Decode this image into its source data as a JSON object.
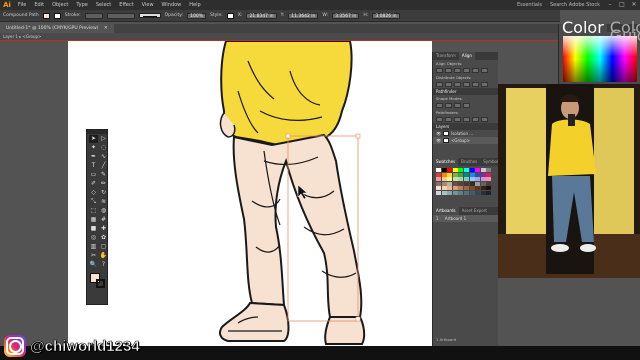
{
  "app": {
    "logo": "Ai",
    "workspace": "Essentials",
    "search_placeholder": "Search Adobe Stock"
  },
  "menu": {
    "items": [
      "File",
      "Edit",
      "Object",
      "Type",
      "Select",
      "Effect",
      "View",
      "Window",
      "Help"
    ]
  },
  "window_buttons": {
    "minimize": "–",
    "maximize": "□",
    "close": "✕"
  },
  "control_bar": {
    "selection_type": "Compound Path",
    "stroke_label": "Stroke:",
    "opacity_label": "Opacity:",
    "opacity_value": "100%",
    "style_label": "Style:",
    "x_label": "X:",
    "x_value": "21.8347 in",
    "y_label": "Y:",
    "y_value": "11.3642 in",
    "w_label": "W:",
    "w_value": "3.3567 in",
    "h_label": "H:",
    "h_value": "3.0826 in"
  },
  "document": {
    "tab_title": "Untitled-1* @ 100% (CMYK/GPU Preview)",
    "close": "✕",
    "breadcrumb": "Layer 1  ▸  <Group>"
  },
  "tools": {
    "icons": [
      "selection-icon",
      "direct-selection-icon",
      "magic-wand-icon",
      "lasso-icon",
      "pen-icon",
      "curvature-icon",
      "type-icon",
      "line-icon",
      "rectangle-icon",
      "paintbrush-icon",
      "shaper-icon",
      "pencil-icon",
      "eraser-icon",
      "rotate-icon",
      "scale-icon",
      "width-icon",
      "free-transform-icon",
      "shape-builder-icon",
      "perspective-icon",
      "mesh-icon",
      "gradient-icon",
      "eyedropper-icon",
      "blend-icon",
      "symbol-sprayer-icon",
      "column-graph-icon",
      "artboard-icon",
      "slice-icon",
      "hand-icon",
      "zoom-icon",
      "question-icon"
    ],
    "glyphs": [
      "➤",
      "▷",
      "✦",
      "◌",
      "✒",
      "∿",
      "T",
      "╱",
      "▭",
      "✎",
      "✐",
      "✏",
      "◇",
      "↻",
      "⤡",
      "≋",
      "⬚",
      "◍",
      "▦",
      "#",
      "■",
      "✚",
      "◎",
      "✿",
      "▥",
      "▢",
      "✂",
      "✋",
      "🔍",
      "?"
    ],
    "fill_color": "#f7e1d0"
  },
  "panels": {
    "top_tabs": [
      "Transform",
      "Align"
    ],
    "align_objects_label": "Align Objects:",
    "distribute_objects_label": "Distribute Objects:",
    "pathfinder_tab": "Pathfinder",
    "shape_modes_label": "Shape Modes:",
    "pathfinders_label": "Pathfinders:",
    "layers_tab": "Layers",
    "layers": [
      {
        "name": "Isolation ...",
        "selected": false
      },
      {
        "name": "<Group>",
        "selected": true
      }
    ],
    "swatch_tabs": [
      "Swatches",
      "Brushes",
      "Symbols"
    ],
    "swatch_colors": [
      "#ffffff",
      "#000000",
      "#ff0000",
      "#ffff00",
      "#00ff00",
      "#00ffff",
      "#0000ff",
      "#ff00ff",
      "#c8c8c8",
      "#808080",
      "#e53935",
      "#fb8c00",
      "#fdd835",
      "#7cb342",
      "#43a047",
      "#00897b",
      "#1e88e5",
      "#3949ab",
      "#8e24aa",
      "#d81b60",
      "#ef9a9a",
      "#ffcc80",
      "#fff59d",
      "#c5e1a5",
      "#a5d6a7",
      "#80cbc4",
      "#90caf9",
      "#9fa8da",
      "#ce93d8",
      "#f48fb1",
      "#8d6e63",
      "#a1887f",
      "#bcaaa4",
      "#6d4c41",
      "#5d4037",
      "#4e342e",
      "#3e2723",
      "#9e9e9e",
      "#616161",
      "#424242",
      "#f7e1d0",
      "#f5d0b0",
      "#e8b890",
      "#d4a070",
      "#b8805a",
      "#9a6644",
      "#7a4c30",
      "#5c3420",
      "#3e2010",
      "#201008",
      "#cfd8dc",
      "#b0bec5",
      "#90a4ae",
      "#78909c",
      "#607d8b",
      "#546e7a",
      "#455a64",
      "#37474f",
      "#263238",
      "#1b2327"
    ],
    "artboards_tabs": [
      "Artboards",
      "Asset Export"
    ],
    "artboards": [
      {
        "index": "1",
        "name": "Artboard 1"
      }
    ],
    "artboards_footer": "1 Artboard"
  },
  "color_panel": {
    "tabs": [
      "Color",
      "Color Guide"
    ]
  },
  "social": {
    "handle": "@chiworld1234"
  },
  "colors": {
    "skin": "#f7e1d0",
    "hoodie": "#f6d93a",
    "outline": "#1a1a1a"
  }
}
